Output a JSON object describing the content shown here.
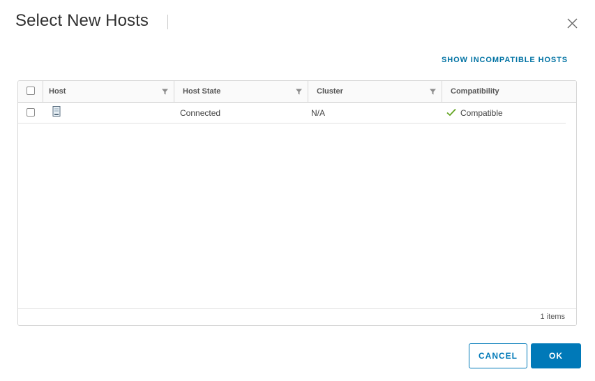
{
  "dialog": {
    "title": "Select New Hosts",
    "show_incompatible_link": "SHOW INCOMPATIBLE HOSTS"
  },
  "grid": {
    "columns": [
      "Host",
      "Host State",
      "Cluster",
      "Compatibility"
    ],
    "rows": [
      {
        "host": "",
        "host_icon": "host-server-icon",
        "host_state": "Connected",
        "cluster": "N/A",
        "compatibility": "Compatible",
        "compatibility_icon": "checkmark-icon"
      }
    ],
    "footer": "1 items"
  },
  "buttons": {
    "cancel": "CANCEL",
    "ok": "OK"
  },
  "colors": {
    "primary": "#0079b8",
    "link": "#0072a3",
    "success": "#62a420"
  }
}
